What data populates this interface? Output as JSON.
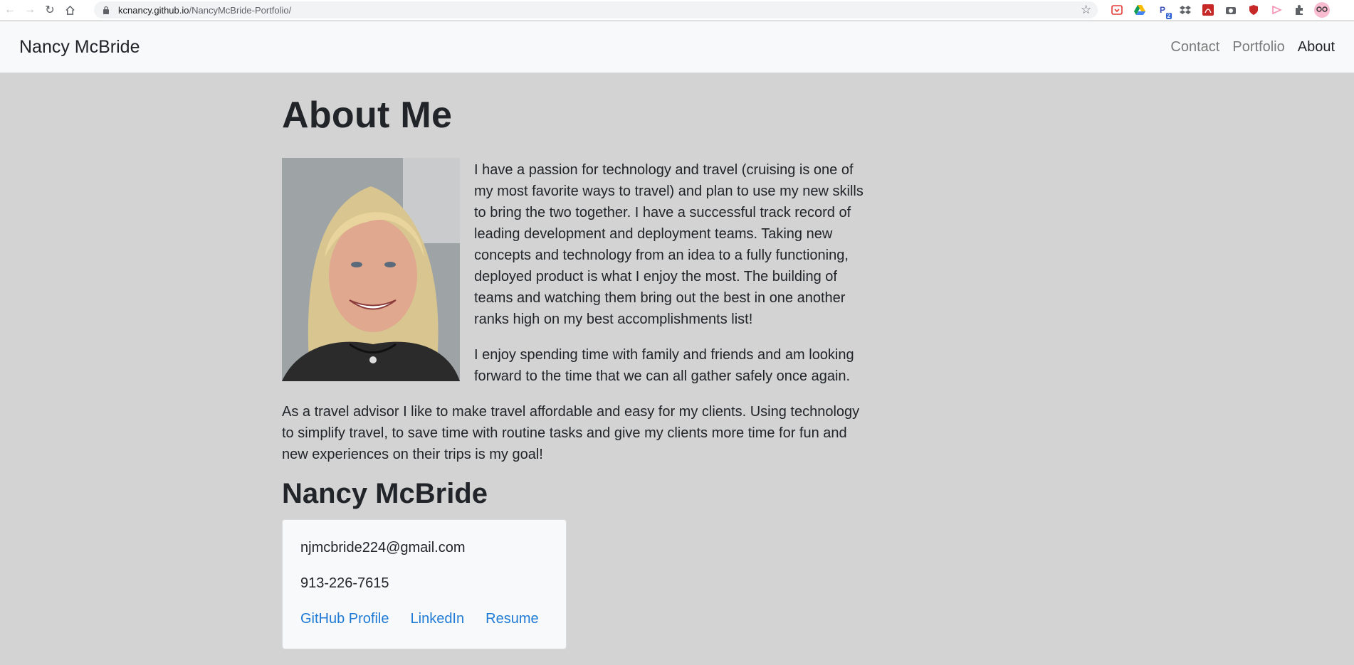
{
  "browser": {
    "url_host": "kcnancy.github.io",
    "url_path": "/NancyMcBride-Portfolio/",
    "extension_badge": "2"
  },
  "navbar": {
    "brand": "Nancy McBride",
    "links": [
      "Contact",
      "Portfolio",
      "About"
    ],
    "active": "About"
  },
  "about": {
    "title": "About Me",
    "paragraph1": "I have a passion for technology and travel (cruising is one of my most favorite ways to travel) and plan to use my new skills to bring the two together. I have a successful track record of leading development and deployment teams. Taking new concepts and technology from an idea to a fully functioning, deployed product is what I enjoy the most. The building of teams and watching them bring out the best in one another ranks high on my best accomplishments list!",
    "paragraph2": "I enjoy spending time with family and friends and am looking forward to the time that we can all gather safely once again.",
    "paragraph3": "As a travel advisor I like to make travel affordable and easy for my clients. Using technology to simplify travel, to save time with routine tasks and give my clients more time for fun and new experiences on their trips is my goal!"
  },
  "contact": {
    "name": "Nancy McBride",
    "email": "njmcbride224@gmail.com",
    "phone": "913-226-7615",
    "links": [
      "GitHub Profile",
      "LinkedIn",
      "Resume"
    ]
  },
  "colors": {
    "page_bg": "#d3d3d3",
    "navbar_bg": "#f8f9fa",
    "link": "#1f7ad6"
  }
}
